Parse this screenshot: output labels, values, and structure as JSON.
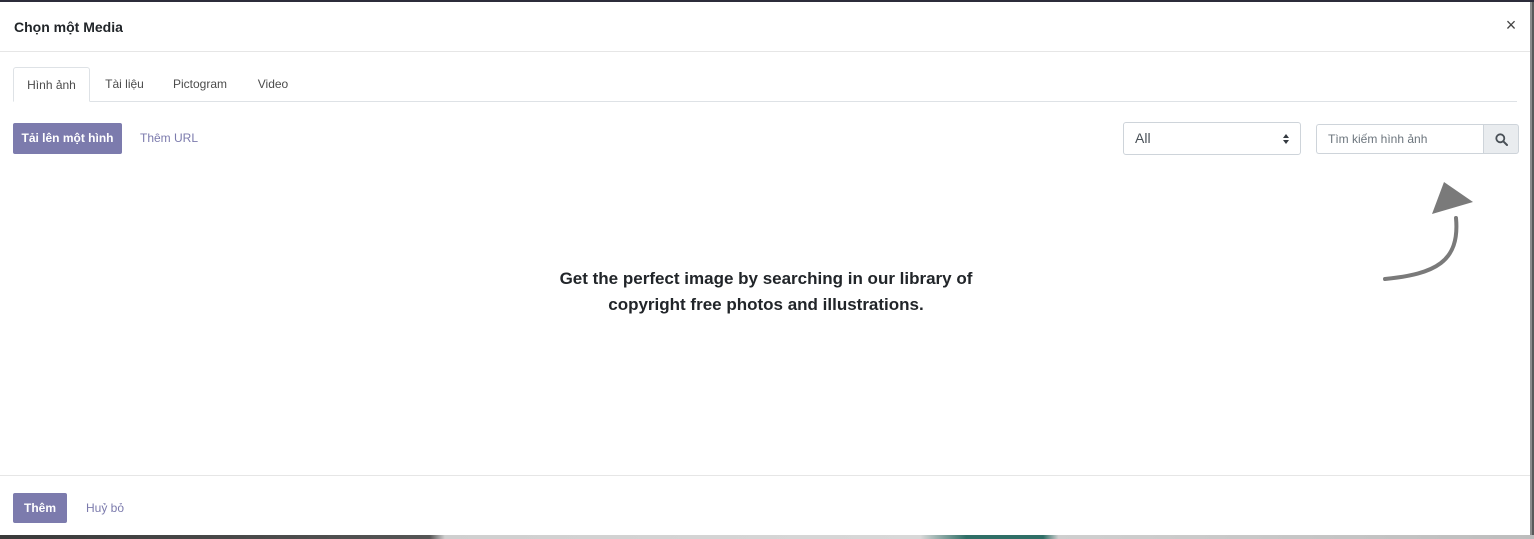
{
  "dialog": {
    "title": "Chọn một Media",
    "close_label": "×"
  },
  "tabs": [
    {
      "label": "Hình ảnh",
      "active": true
    },
    {
      "label": "Tài liệu",
      "active": false
    },
    {
      "label": "Pictogram",
      "active": false
    },
    {
      "label": "Video",
      "active": false
    }
  ],
  "toolbar": {
    "upload_label": "Tải lên một hình",
    "add_url_label": "Thêm URL",
    "filter_selected": "All",
    "search_placeholder": "Tìm kiếm hình ảnh",
    "search_icon": "search-icon"
  },
  "main": {
    "empty_message": "Get the perfect image by searching in our library of copyright free photos and illustrations.",
    "hint_icon": "curved-arrow-up-icon"
  },
  "footer": {
    "add_label": "Thêm",
    "cancel_label": "Huỷ bỏ"
  },
  "colors": {
    "primary": "#7c7bad",
    "text": "#212529",
    "border": "#dee2e6"
  }
}
